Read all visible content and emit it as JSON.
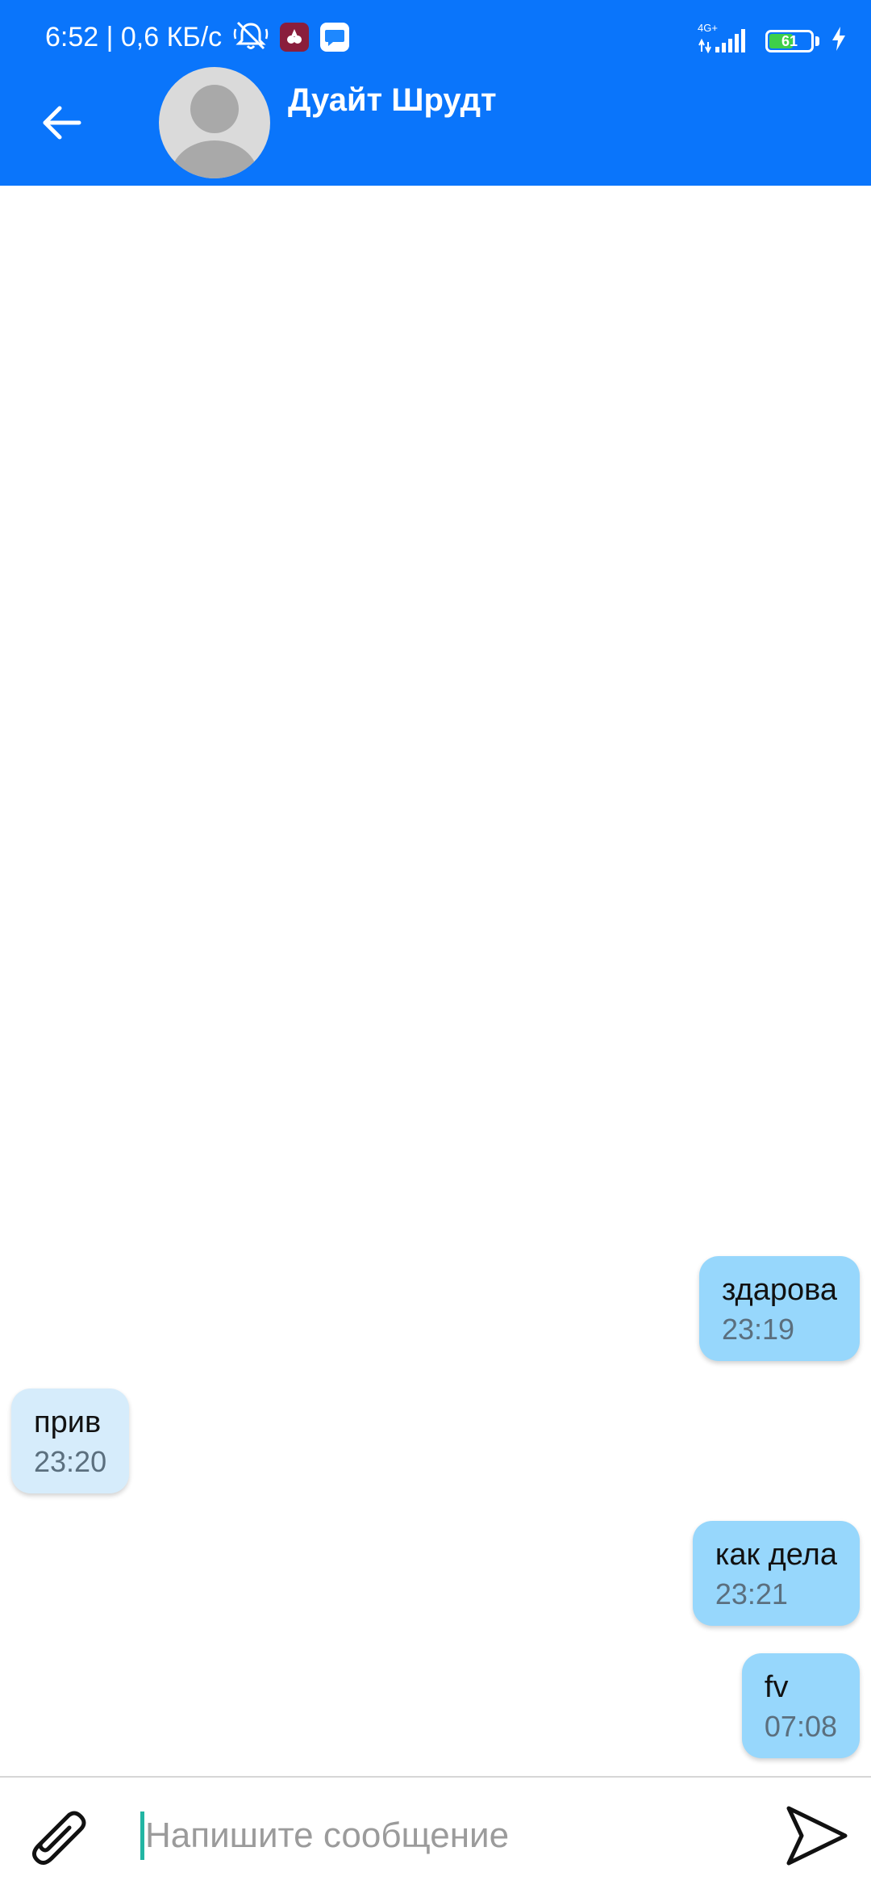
{
  "status_bar": {
    "time_and_speed": "6:52 | 0,6 КБ/с",
    "network": "4G+",
    "battery_level": "61",
    "battery_fraction": 0.61,
    "icons": [
      "muted-bell-icon",
      "app-notification-icon",
      "messenger-notification-icon",
      "signal-icon",
      "battery-icon",
      "charging-icon"
    ]
  },
  "header": {
    "contact_name": "Дуайт Шрудт",
    "back_icon": "arrow-left-icon",
    "avatar_icon": "default-avatar-icon"
  },
  "messages": [
    {
      "direction": "outgoing",
      "text": "здарова",
      "time": "23:19"
    },
    {
      "direction": "incoming",
      "text": "прив",
      "time": "23:20"
    },
    {
      "direction": "outgoing",
      "text": "как дела",
      "time": "23:21"
    },
    {
      "direction": "outgoing",
      "text": "fv",
      "time": "07:08"
    }
  ],
  "composer": {
    "placeholder": "Напишите сообщение",
    "value": "",
    "attach_icon": "paperclip-icon",
    "send_icon": "send-icon"
  },
  "colors": {
    "header_bg": "#0a75fb",
    "outgoing_bubble": "#97d7fc",
    "incoming_bubble": "#d6ecfb",
    "caret": "#22b5a3"
  }
}
